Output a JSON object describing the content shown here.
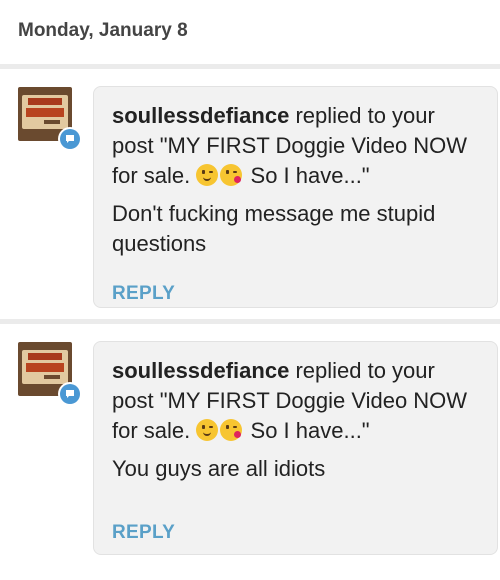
{
  "date_header": "Monday, January 8",
  "notifications": [
    {
      "username": "soullessdefiance",
      "action_text": "replied to your post \"MY FIRST Doggie Video NOW for sale.",
      "post_suffix": "So I have...\"",
      "emojis": [
        "winking-tongue-emoji",
        "kissing-heart-emoji"
      ],
      "comment": "Don't fucking message me stupid questions",
      "reply_label": "REPLY"
    },
    {
      "username": "soullessdefiance",
      "action_text": "replied to your post \"MY FIRST Doggie Video NOW for sale.",
      "post_suffix": "So I have...\"",
      "emojis": [
        "winking-tongue-emoji",
        "kissing-heart-emoji"
      ],
      "comment": "You guys are all idiots",
      "reply_label": "REPLY"
    }
  ],
  "colors": {
    "reply_link": "#5aa0c8",
    "badge": "#4a98d4",
    "bubble_bg": "#f2f2f2"
  }
}
